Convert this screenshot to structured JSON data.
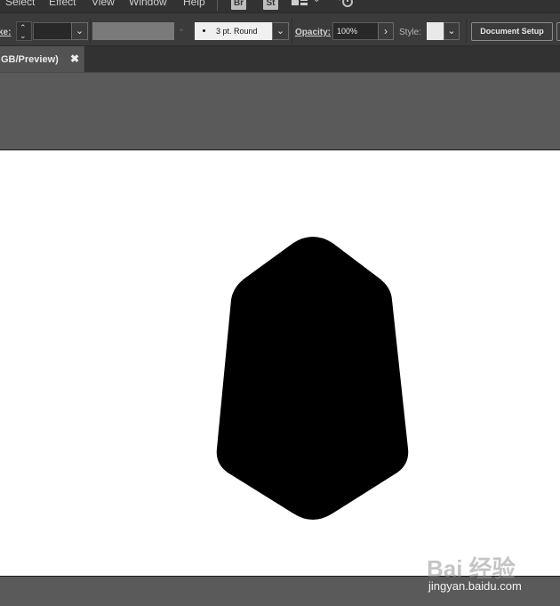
{
  "menubar": {
    "items": [
      "Select",
      "Effect",
      "View",
      "Window",
      "Help"
    ],
    "bridge_badge": "Br",
    "stock_badge": "St"
  },
  "controlbar": {
    "stroke_label": "ke:",
    "brush_value": "3 pt. Round",
    "opacity_label": "Opacity:",
    "opacity_value": "100%",
    "style_label": "Style:",
    "document_setup_label": "Document Setup"
  },
  "tab": {
    "title": "GB/Preview)",
    "close_glyph": "✖"
  },
  "artwork": {
    "shape_fill": "#000000",
    "artboard_color": "#ffffff"
  },
  "watermark": {
    "logo_text": "Bai 经验",
    "url": "jingyan.baidu.com"
  }
}
